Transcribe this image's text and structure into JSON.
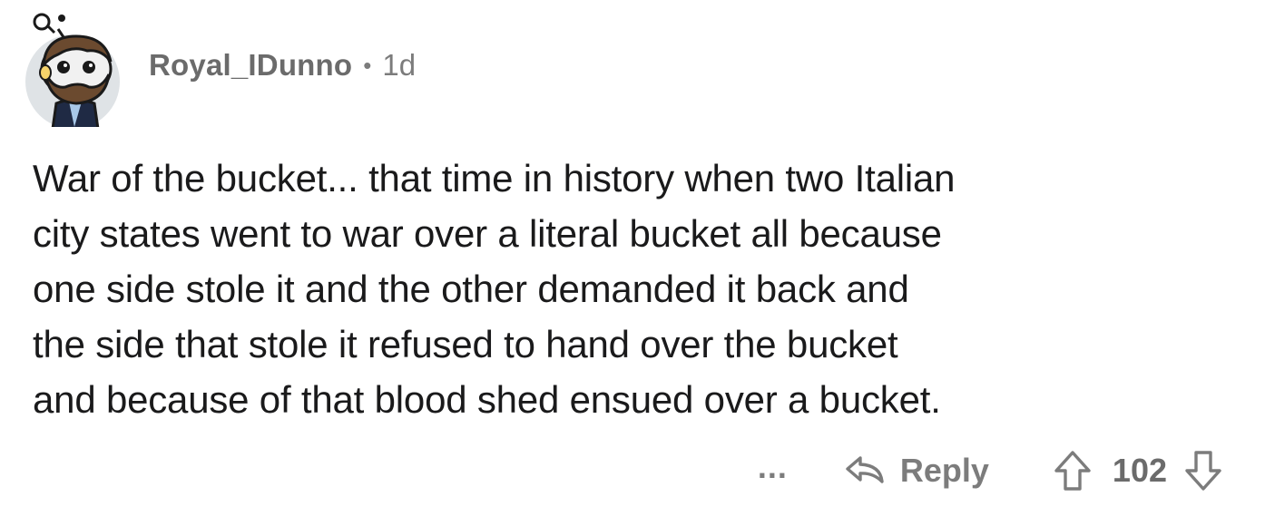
{
  "comment": {
    "username": "Royal_IDunno",
    "separator": "•",
    "age": "1d",
    "body_lines": [
      "War of the bucket... that time in history when two Italian",
      "city states went to war over a literal bucket all because",
      "one side stole it and the other demanded it back and",
      "the side that stole it refused to hand over the bucket",
      "and because of that blood shed ensued over a bucket."
    ],
    "actions": {
      "more_label": "...",
      "reply_label": "Reply",
      "score": "102"
    },
    "icons": {
      "avatar": "reddit-snoo-avatar",
      "reply": "reply-arrow-icon",
      "upvote": "upvote-arrow-icon",
      "downvote": "downvote-arrow-icon"
    },
    "colors": {
      "muted_text": "#7c7c7c",
      "body_text": "#1a1a1b",
      "avatar_bg": "#dfe3e6"
    }
  }
}
